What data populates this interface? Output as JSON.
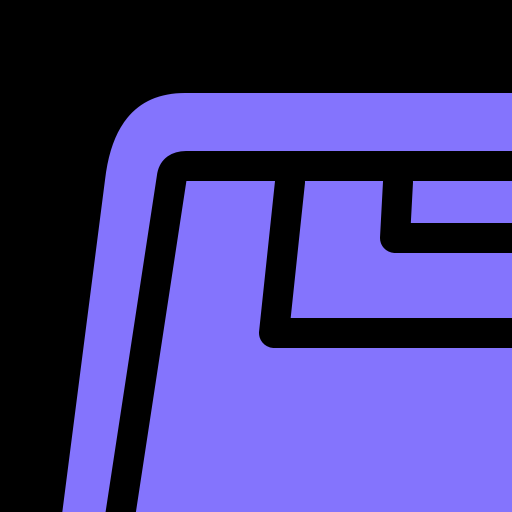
{
  "icon": {
    "name": "skewed-panel-icon",
    "colors": {
      "background": "#000000",
      "fill": "#8474FD",
      "stroke": "#000000"
    }
  }
}
